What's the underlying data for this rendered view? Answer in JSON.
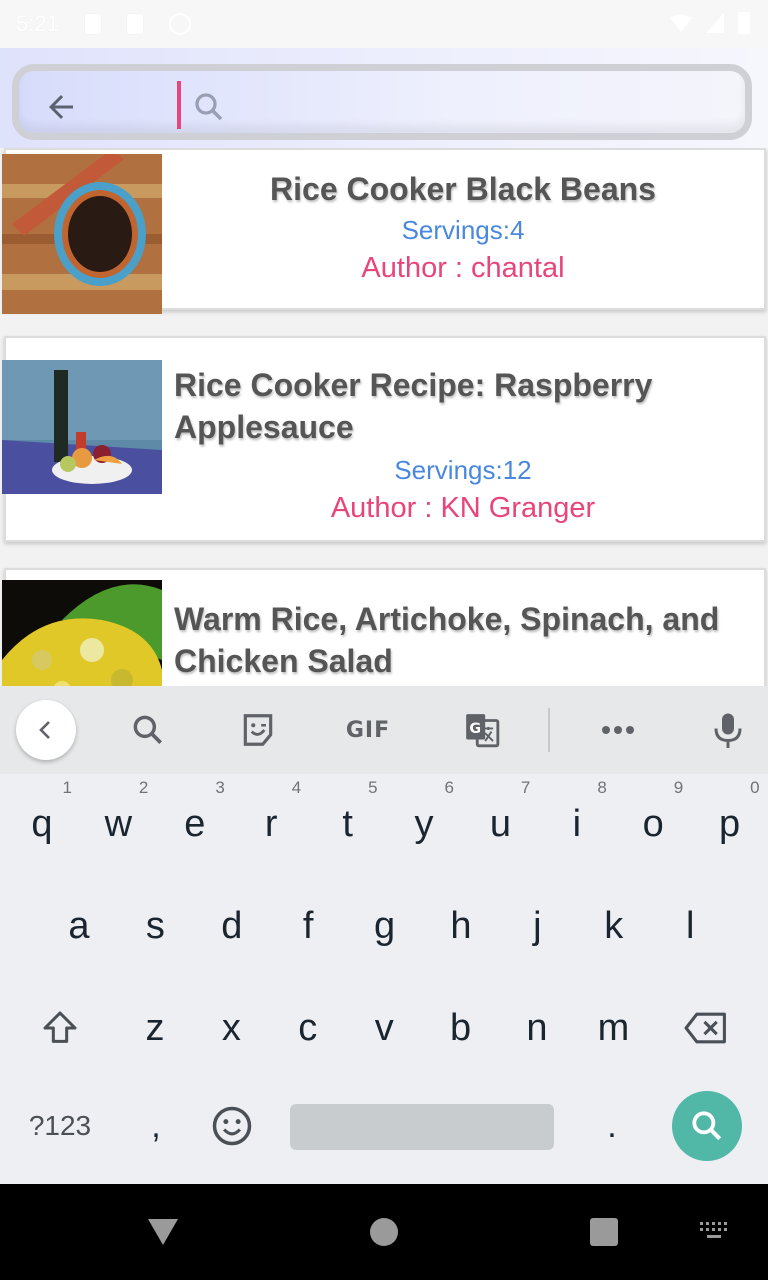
{
  "status_bar": {
    "time": "5:21",
    "icons": [
      "notification-icon",
      "sd-card-icon",
      "sync-icon",
      "wifi-icon",
      "signal-icon",
      "battery-icon"
    ]
  },
  "search": {
    "back_icon": "arrow-left-icon",
    "placeholder_icon": "search-icon",
    "value": "",
    "cursor_color": "#e8457a"
  },
  "recipes": [
    {
      "title": "Rice Cooker Black Beans",
      "servings": "Servings:4",
      "author": "Author : chantal",
      "thumbnail": "black-beans-photo"
    },
    {
      "title": "Rice Cooker Recipe: Raspberry Applesauce",
      "servings": "Servings:12",
      "author": "Author : KN Granger",
      "thumbnail": "seaside-picnic-photo"
    },
    {
      "title": "Warm Rice, Artichoke, Spinach, and Chicken Salad",
      "thumbnail": "rice-salad-photo"
    }
  ],
  "colors": {
    "servings": "#4a88e0",
    "author": "#e8457a",
    "title": "#555555",
    "keyboard_action": "#51b8a8"
  },
  "keyboard": {
    "toolbar": [
      "collapse-icon",
      "search-icon",
      "sticker-icon",
      "GIF",
      "translate-icon",
      "more-icon",
      "microphone-icon"
    ],
    "gif_label": "GIF",
    "row1": [
      {
        "k": "q",
        "h": "1"
      },
      {
        "k": "w",
        "h": "2"
      },
      {
        "k": "e",
        "h": "3"
      },
      {
        "k": "r",
        "h": "4"
      },
      {
        "k": "t",
        "h": "5"
      },
      {
        "k": "y",
        "h": "6"
      },
      {
        "k": "u",
        "h": "7"
      },
      {
        "k": "i",
        "h": "8"
      },
      {
        "k": "o",
        "h": "9"
      },
      {
        "k": "p",
        "h": "0"
      }
    ],
    "row2": [
      "a",
      "s",
      "d",
      "f",
      "g",
      "h",
      "j",
      "k",
      "l"
    ],
    "row3": [
      "z",
      "x",
      "c",
      "v",
      "b",
      "n",
      "m"
    ],
    "symbols_label": "?123",
    "comma_label": ",",
    "period_label": "."
  },
  "nav_bar": {
    "buttons": [
      "back-triangle-icon",
      "home-circle-icon",
      "recents-square-icon",
      "keyboard-switch-icon"
    ]
  }
}
